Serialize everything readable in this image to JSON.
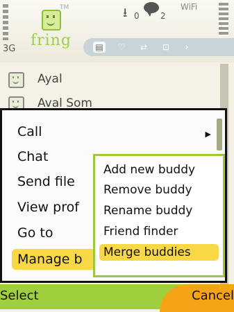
{
  "status_bar": {
    "network_label": "3G",
    "logo_tm": "TM",
    "logo_text": "fring",
    "downloads_count": "0",
    "messages_count": "2",
    "wifi_label": "WiFi"
  },
  "tabs": [
    {
      "icon": "list-icon",
      "symbol": "▤"
    },
    {
      "icon": "chat-tab-icon",
      "symbol": "♡"
    },
    {
      "icon": "transfer-icon",
      "symbol": "⇄"
    },
    {
      "icon": "add-contact-icon",
      "symbol": "⊡"
    },
    {
      "icon": "next-icon",
      "symbol": "›"
    }
  ],
  "contacts": [
    {
      "label": "Ayal"
    },
    {
      "label": "Aval Som"
    }
  ],
  "menu": {
    "items": [
      "Call",
      "Chat",
      "Send file",
      "View prof",
      "Go to",
      "Manage b"
    ],
    "selected": "Manage b"
  },
  "submenu": {
    "items": [
      "Add new buddy",
      "Remove buddy",
      "Rename buddy",
      "Friend finder",
      "Merge buddies"
    ],
    "selected": "Merge buddies"
  },
  "softkeys": {
    "left": "Select",
    "right": "Cancel"
  },
  "colors": {
    "accent_green": "#9fcf3d",
    "highlight_yellow": "#f8d844",
    "cancel_orange": "#f5a418"
  }
}
